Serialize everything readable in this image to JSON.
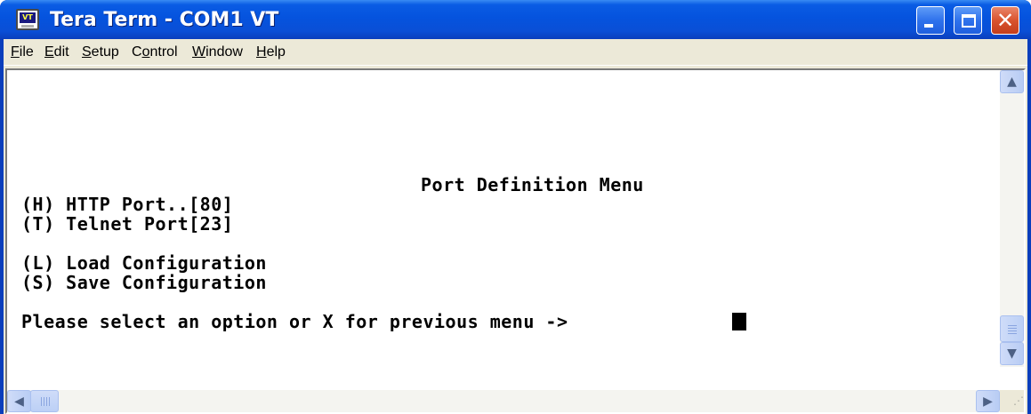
{
  "window": {
    "title": "Tera Term - COM1 VT",
    "app_icon": "teraterm-icon",
    "app_icon_label": "VT",
    "controls": {
      "minimize_icon": "minimize-icon",
      "maximize_icon": "maximize-icon",
      "close_icon": "close-icon",
      "close_glyph": "✕"
    }
  },
  "menu": [
    {
      "pre": "",
      "u": "F",
      "post": "ile"
    },
    {
      "pre": "",
      "u": "E",
      "post": "dit"
    },
    {
      "pre": "",
      "u": "S",
      "post": "etup"
    },
    {
      "pre": "C",
      "u": "o",
      "post": "ntrol"
    },
    {
      "pre": "",
      "u": "W",
      "post": "indow"
    },
    {
      "pre": "",
      "u": "H",
      "post": "elp"
    }
  ],
  "terminal": {
    "heading": "Port Definition Menu",
    "lines": [
      "(H) HTTP Port..[80]",
      "(T) Telnet Port[23]",
      "",
      "(L) Load Configuration",
      "(S) Save Configuration",
      "",
      "Please select an option or X for previous menu -> "
    ]
  },
  "scrollbars": {
    "up_glyph": "▲",
    "down_glyph": "▼",
    "left_glyph": "◀",
    "right_glyph": "▶",
    "size_grip": "⋰"
  },
  "colors": {
    "titlebar": "#0553de",
    "close_button": "#d9532e",
    "window_face": "#ece9d8",
    "terminal_bg": "#ffffff",
    "terminal_fg": "#000000"
  }
}
